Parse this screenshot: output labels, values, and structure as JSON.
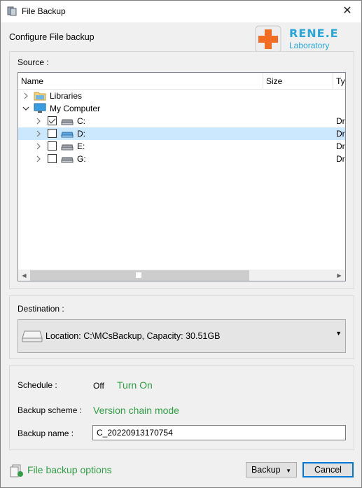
{
  "window": {
    "title": "File Backup",
    "close_glyph": "✕"
  },
  "header": {
    "configure_label": "Configure File backup"
  },
  "logo": {
    "line1": "RENE.E",
    "line2": "Laboratory"
  },
  "source": {
    "label": "Source :",
    "columns": {
      "name": "Name",
      "size": "Size",
      "type": "Ty"
    },
    "rows": [
      {
        "label": "Libraries",
        "type": ""
      },
      {
        "label": "My Computer",
        "type": ""
      },
      {
        "label": "C:",
        "type": "Dr",
        "checked": true
      },
      {
        "label": "D:",
        "type": "Dr",
        "checked": false,
        "selected": true
      },
      {
        "label": "E:",
        "type": "Dr",
        "checked": false
      },
      {
        "label": "G:",
        "type": "Dr",
        "checked": false
      }
    ]
  },
  "destination": {
    "label": "Destination :",
    "location_text": "Location: C:\\MCsBackup, Capacity: 30.51GB",
    "dropdown_glyph": "▼"
  },
  "schedule": {
    "label": "Schedule :",
    "state": "Off",
    "turn_on": "Turn On"
  },
  "backup_scheme": {
    "label": "Backup scheme :",
    "value": "Version chain mode"
  },
  "backup_name": {
    "label": "Backup name :",
    "value": "C_20220913170754"
  },
  "footer": {
    "options_link": "File backup options",
    "backup_button": "Backup",
    "backup_arrow": "▼",
    "cancel_button": "Cancel"
  },
  "colors": {
    "accent_green": "#2f9e44",
    "selection": "#cce8ff",
    "logo_blue": "#2aa6d8"
  },
  "icons": [
    "app-backup-icon",
    "close-icon",
    "rene-logo-icon",
    "libraries-folder-icon",
    "computer-icon",
    "drive-icon",
    "disk-icon",
    "options-icon"
  ]
}
